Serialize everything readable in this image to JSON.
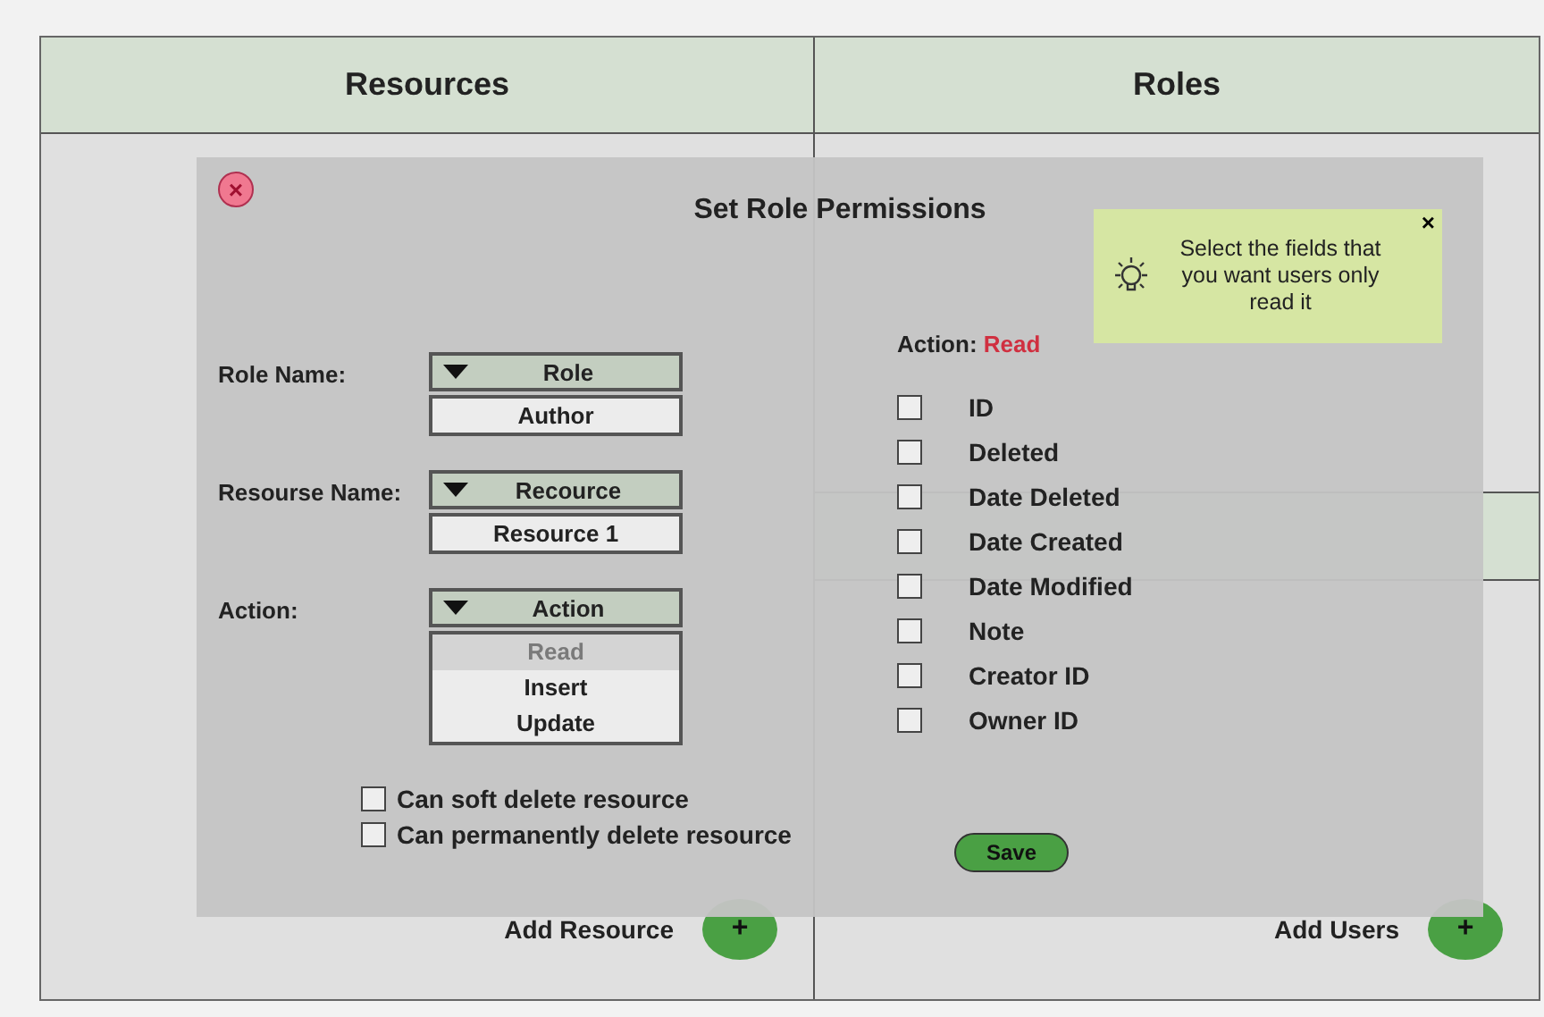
{
  "left_panel": {
    "title": "Resources",
    "add_label": "Add Resource",
    "add_button": "+"
  },
  "right_panel": {
    "sections": [
      {
        "title": "Roles"
      },
      {
        "add_label": "Add Users",
        "add_button": "+"
      }
    ]
  },
  "dialog": {
    "title": "Set Role Permissions",
    "close": "×",
    "fields": [
      {
        "label": "Role Name:",
        "dropdown": "Role",
        "value": "Author"
      },
      {
        "label": "Resourse Name:",
        "dropdown": "Recource",
        "value": "Resource 1"
      },
      {
        "label": "Action:",
        "dropdown": "Action",
        "options": [
          {
            "text": "Read",
            "selected": true
          },
          {
            "text": "Insert",
            "selected": false
          },
          {
            "text": "Update",
            "selected": false
          }
        ]
      }
    ],
    "options": [
      {
        "label": "Can soft delete resource",
        "checked": false
      },
      {
        "label": "Can permanently delete resource",
        "checked": false
      }
    ],
    "action_label": "Action:",
    "action_value": "Read",
    "columns": [
      {
        "label": "ID",
        "checked": false
      },
      {
        "label": "Deleted",
        "checked": false
      },
      {
        "label": "Date Deleted",
        "checked": false
      },
      {
        "label": "Date Created",
        "checked": false
      },
      {
        "label": "Date Modified",
        "checked": false
      },
      {
        "label": "Note",
        "checked": false
      },
      {
        "label": "Creator ID",
        "checked": false
      },
      {
        "label": "Owner ID",
        "checked": false
      }
    ],
    "save": "Save",
    "tip": {
      "text": "Select the fields that you want users only read it",
      "close": "×"
    }
  }
}
